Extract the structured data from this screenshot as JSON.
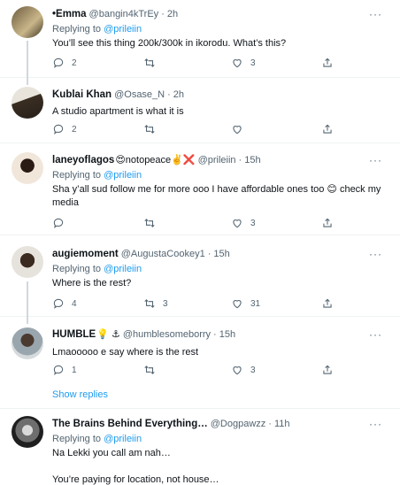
{
  "replies": [
    {
      "name": "•Emma",
      "handle": "@bangin4kTrEy",
      "time": "2h",
      "replying_label": "Replying to",
      "replying_to": "@prileiin",
      "text": "You’ll see this thing 200k/300k in ikorodu. What’s this?",
      "reply_count": "2",
      "retweet_count": "",
      "like_count": "3"
    },
    {
      "name": "Kublai Khan",
      "handle": "@Osase_N",
      "time": "2h",
      "text": "A studio apartment is what it is",
      "reply_count": "2",
      "retweet_count": "",
      "like_count": ""
    },
    {
      "name": "laneyoflagos",
      "name_emoji": "😍notopeace✌️❌",
      "handle": "@prileiin",
      "time": "15h",
      "replying_label": "Replying to",
      "replying_to": "@prileiin",
      "text": "Sha y’all sud follow me for more ooo I have affordable ones too 😊 check my media",
      "reply_count": "",
      "retweet_count": "",
      "like_count": "3"
    },
    {
      "name": "augiemoment",
      "handle": "@AugustaCookey1",
      "time": "15h",
      "replying_label": "Replying to",
      "replying_to": "@prileiin",
      "text": "Where is the rest?",
      "reply_count": "4",
      "retweet_count": "3",
      "like_count": "31"
    },
    {
      "name": "HUMBLE",
      "name_emoji": "💡 ⚓",
      "handle": "@humblesomeborry",
      "time": "15h",
      "text": "Lmaooooo e say where is the rest",
      "reply_count": "1",
      "retweet_count": "",
      "like_count": "3"
    },
    {
      "name": "The Brains Behind Everything…",
      "handle": "@Dogpawzz",
      "time": "11h",
      "replying_label": "Replying to",
      "replying_to": "@prileiin",
      "text": "Na Lekki you call am nah…",
      "text2": "You’re paying for location, not house…"
    }
  ],
  "show_replies_label": "Show replies",
  "more_label": "···",
  "colors": {
    "accent": "#1d9bf0",
    "muted": "#536471",
    "text": "#0f1419",
    "divider": "#eff3f4"
  }
}
